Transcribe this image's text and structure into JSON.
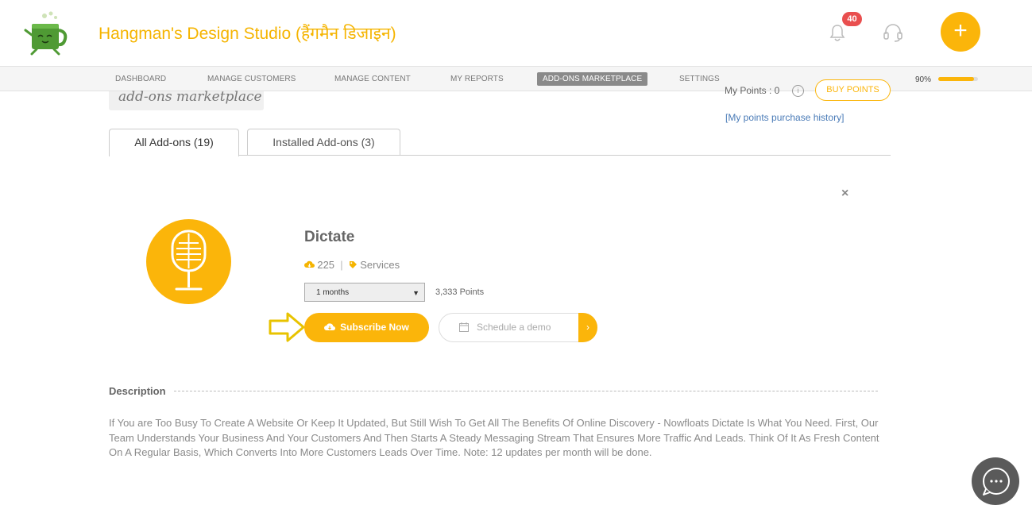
{
  "header": {
    "site_title": "Hangman's Design Studio (हैंगमैन डिजाइन)",
    "notification_count": "40",
    "add_button": "+"
  },
  "nav": {
    "items": [
      "DASHBOARD",
      "MANAGE CUSTOMERS",
      "MANAGE CONTENT",
      "MY REPORTS",
      "ADD-ONS MARKETPLACE",
      "SETTINGS"
    ],
    "active_index": 4,
    "progress_label": "90%",
    "progress_value": 0.9
  },
  "page": {
    "heading": "add-ons marketplace",
    "my_points": "My Points : 0",
    "info_glyph": "i",
    "buy_points": "BUY POINTS",
    "history_link": "[My points purchase history]"
  },
  "tabs": [
    {
      "label": "All Add-ons (19)",
      "active": true
    },
    {
      "label": "Installed Add-ons (3)",
      "active": false
    }
  ],
  "addon": {
    "close_glyph": "×",
    "title": "Dictate",
    "downloads": "225",
    "separator": "|",
    "category": "Services",
    "duration_selected": "1 months",
    "caret": "▼",
    "price": "3,333 Points",
    "subscribe_label": "Subscribe Now",
    "demo_placeholder": "Schedule a demo",
    "demo_go": "›"
  },
  "description": {
    "label": "Description",
    "text": "If You are Too Busy To Create A Website Or Keep It Updated, But Still Wish To Get All The Benefits Of Online Discovery - Nowfloats Dictate Is What You Need. First, Our Team Understands Your Business And Your Customers And Then Starts A Steady Messaging Stream That Ensures More Traffic And Leads. Think Of It As Fresh Content On A Regular Basis, Which Converts Into More Customers Leads Over Time. Note: 12 updates per month will be done."
  },
  "colors": {
    "accent": "#fbb50a",
    "title": "#f5b400",
    "badge": "#e94f4f",
    "link": "#4a7bb7"
  },
  "icons": {
    "logo": "teacup-mascot-icon",
    "bell": "bell-icon",
    "support": "headset-icon",
    "microphone": "microphone-icon",
    "download": "cloud-download-icon",
    "tag": "tag-icon",
    "calendar": "calendar-icon",
    "chat": "chat-bubble-icon"
  }
}
